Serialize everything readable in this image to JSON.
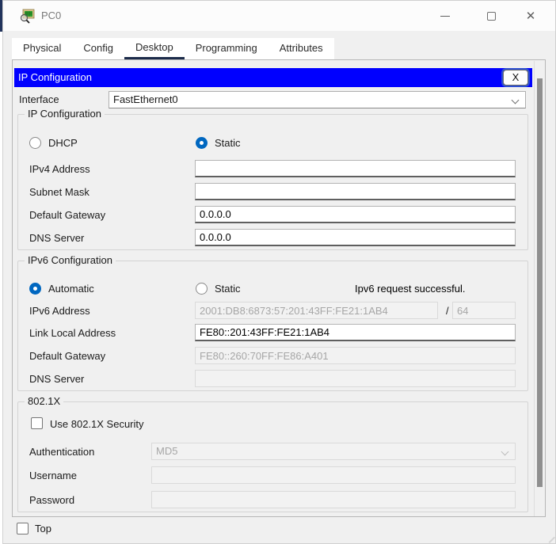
{
  "colors": {
    "dialog_titlebar_blue": "#0000ff",
    "radio_accent_blue": "#0067c0",
    "active_tab_underline": "#1c2b4a",
    "disabled_text_gray": "#a6a6a6"
  },
  "window": {
    "title": "PC0"
  },
  "tabs": [
    {
      "label": "Physical"
    },
    {
      "label": "Config"
    },
    {
      "label": "Desktop"
    },
    {
      "label": "Programming"
    },
    {
      "label": "Attributes"
    }
  ],
  "dialog": {
    "title": "IP Configuration",
    "close_label": "X",
    "interface_label": "Interface",
    "interface_value": "FastEthernet0"
  },
  "ipv4": {
    "legend": "IP Configuration",
    "dhcp_label": "DHCP",
    "static_label": "Static",
    "fields": [
      {
        "label": "IPv4 Address",
        "value": ""
      },
      {
        "label": "Subnet Mask",
        "value": ""
      },
      {
        "label": "Default Gateway",
        "value": "0.0.0.0"
      },
      {
        "label": "DNS Server",
        "value": "0.0.0.0"
      }
    ]
  },
  "ipv6": {
    "legend": "IPv6 Configuration",
    "automatic_label": "Automatic",
    "static_label": "Static",
    "status": "Ipv6 request successful.",
    "address_label": "IPv6 Address",
    "address_value": "2001:DB8:6873:57:201:43FF:FE21:1AB4",
    "prefix_separator": "/",
    "prefix_value": "64",
    "fields": [
      {
        "label": "Link Local Address",
        "value": "FE80::201:43FF:FE21:1AB4"
      },
      {
        "label": "Default Gateway",
        "value": "FE80::260:70FF:FE86:A401"
      },
      {
        "label": "DNS Server",
        "value": ""
      }
    ]
  },
  "dot1x": {
    "legend": "802.1X",
    "security_checkbox_label": "Use 802.1X Security",
    "auth_label": "Authentication",
    "auth_value": "MD5",
    "username_label": "Username",
    "password_label": "Password",
    "username_value": "",
    "password_value": ""
  },
  "footer": {
    "top_label": "Top"
  }
}
